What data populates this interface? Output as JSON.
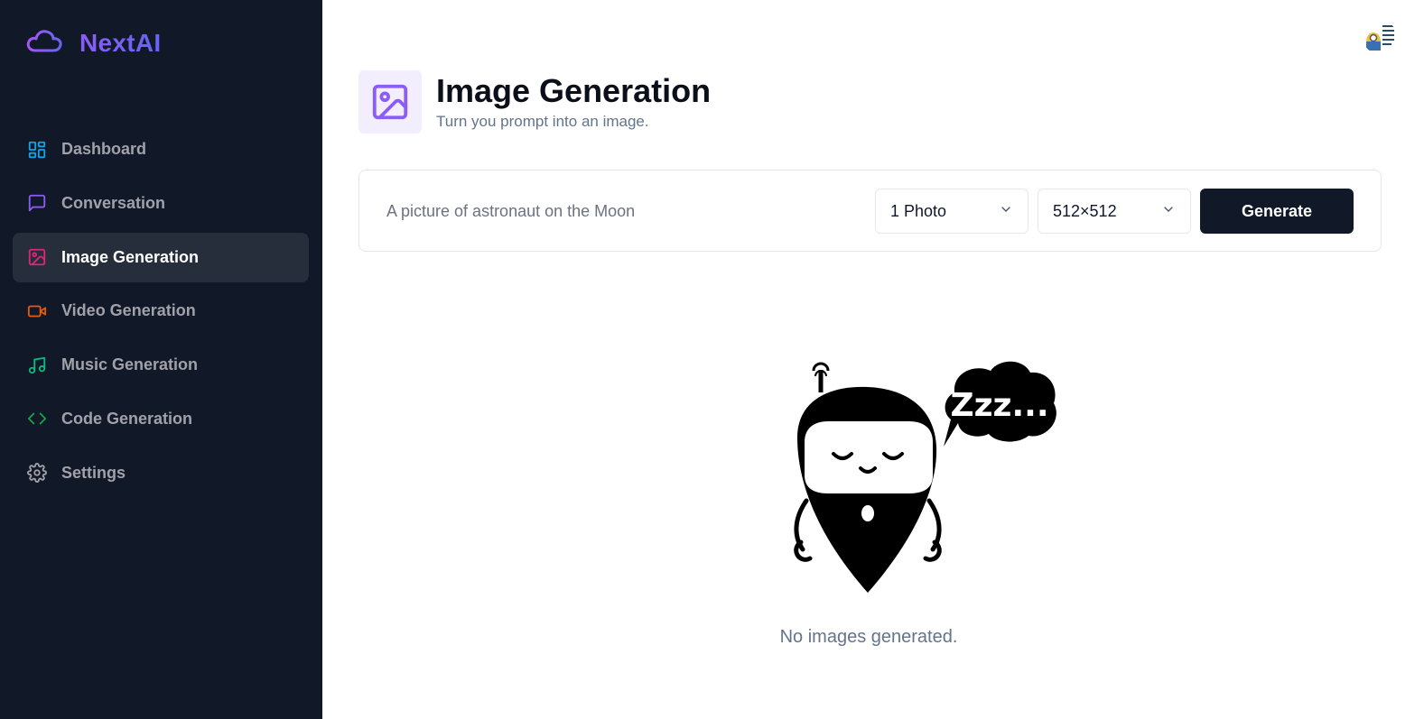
{
  "app": {
    "name": "NextAI",
    "brand_colors": [
      "#8b5cf6",
      "#6366f1"
    ]
  },
  "sidebar": {
    "items": [
      {
        "label": "Dashboard",
        "icon": "dashboard-icon",
        "color": "#0ea5e9",
        "active": false
      },
      {
        "label": "Conversation",
        "icon": "message-square-icon",
        "color": "#8b5cf6",
        "active": false
      },
      {
        "label": "Image Generation",
        "icon": "image-icon",
        "color": "#db2777",
        "active": true
      },
      {
        "label": "Video Generation",
        "icon": "video-icon",
        "color": "#ea580c",
        "active": false
      },
      {
        "label": "Music Generation",
        "icon": "music-icon",
        "color": "#10b981",
        "active": false
      },
      {
        "label": "Code Generation",
        "icon": "code-icon",
        "color": "#16a34a",
        "active": false
      },
      {
        "label": "Settings",
        "icon": "gear-icon",
        "color": "#a1a1aa",
        "active": false
      }
    ]
  },
  "header": {
    "title": "Image Generation",
    "subtitle": "Turn you prompt into an image.",
    "icon": "image-icon",
    "icon_color": "#8b5cf6"
  },
  "form": {
    "prompt": {
      "value": "",
      "placeholder": "A picture of astronaut on the Moon"
    },
    "amount": {
      "selected": "1 Photo"
    },
    "resolution": {
      "selected": "512×512"
    },
    "generate_label": "Generate"
  },
  "empty_state": {
    "text": "No images generated.",
    "bubble_text": "Zzz...",
    "illustration": "sleeping-robot"
  }
}
